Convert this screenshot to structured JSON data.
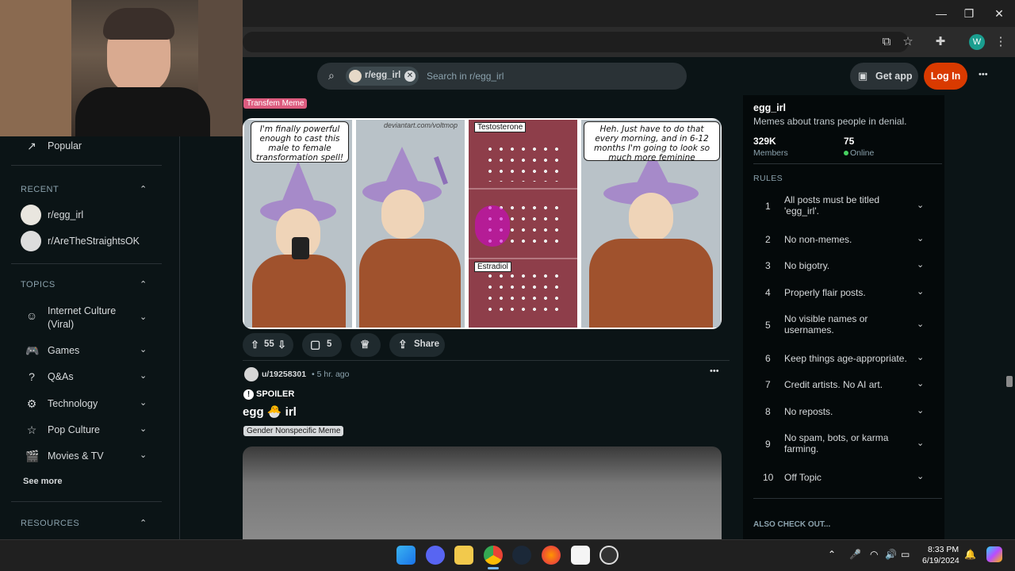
{
  "browser": {
    "profile_initial": "W",
    "window_buttons": [
      "—",
      "❐",
      "✕"
    ]
  },
  "header": {
    "search_chip": "r/egg_irl",
    "search_placeholder": "Search in r/egg_irl",
    "get_app": "Get app",
    "login": "Log In",
    "more": "•••"
  },
  "sidebar": {
    "popular": "Popular",
    "recent_heading": "RECENT",
    "recent": [
      "r/egg_irl",
      "r/AreTheStraightsOK"
    ],
    "topics_heading": "TOPICS",
    "topics": [
      "Internet Culture",
      "(Viral)",
      "Games",
      "Q&As",
      "Technology",
      "Pop Culture",
      "Movies & TV"
    ],
    "see_more": "See more",
    "resources_heading": "RESOURCES"
  },
  "post1": {
    "flair": "Transfem Meme",
    "panel1_text": "I'm finally powerful enough to cast this male to female transformation spell!",
    "watermark": "deviantart.com/voltmop",
    "label_t": "Testosterone",
    "label_e": "Estradiol",
    "panel4_text": "Heh. Just have to do that every morning, and in 6-12 months I'm going to look so much more feminine",
    "votes": "55",
    "comments": "5",
    "share": "Share"
  },
  "post2": {
    "user": "u/19258301",
    "time": "• 5 hr. ago",
    "spoiler": "SPOILER",
    "title": "egg 🐣 irl",
    "flair": "Gender Nonspecific Meme",
    "more": "•••"
  },
  "community": {
    "name": "egg_irl",
    "description": "Memes about trans people in denial.",
    "members_count": "329K",
    "members_label": "Members",
    "online_count": "75",
    "online_label": "Online",
    "rules_heading": "RULES",
    "rules": [
      {
        "n": "1",
        "text": "All posts must be titled 'egg_irl'."
      },
      {
        "n": "2",
        "text": "No non-memes."
      },
      {
        "n": "3",
        "text": "No bigotry."
      },
      {
        "n": "4",
        "text": "Properly flair posts."
      },
      {
        "n": "5",
        "text": "No visible names or usernames."
      },
      {
        "n": "6",
        "text": "Keep things age-appropriate."
      },
      {
        "n": "7",
        "text": "Credit artists. No AI art."
      },
      {
        "n": "8",
        "text": "No reposts."
      },
      {
        "n": "9",
        "text": "No spam, bots, or karma farming."
      },
      {
        "n": "10",
        "text": "Off Topic"
      }
    ],
    "also_check": "ALSO CHECK OUT..."
  },
  "taskbar": {
    "time": "8:33 PM",
    "date": "6/19/2024"
  },
  "colors": {
    "login": "#d93a00",
    "online_dot": "#46d160",
    "flair_transfem": "#dd5c7f"
  }
}
